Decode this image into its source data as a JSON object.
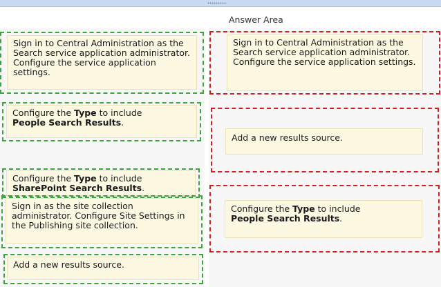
{
  "answer_area": {
    "title": "Answer Area"
  },
  "source_items": [
    {
      "text": "Sign in to Central Administration as the Search service application administrator. Configure the service application settings."
    },
    {
      "before": "Configure the ",
      "bold1": "Type",
      "middle": " to include ",
      "bold2": "People Search Results",
      "after": "."
    },
    {
      "before": "Configure the ",
      "bold1": "Type",
      "middle": " to include ",
      "bold2": "SharePoint Search Results",
      "after": "."
    },
    {
      "text": "Sign in as the site collection administrator. Configure Site Settings in the Publishing site collection."
    },
    {
      "text": "Add a new results source."
    }
  ],
  "answer_slots": [
    {
      "text": "Sign in to Central Administration as the Search service application administrator. Configure the service application settings."
    },
    {
      "text": "Add a new results source."
    },
    {
      "before": "Configure the ",
      "bold1": "Type",
      "middle": " to include ",
      "bold2": "People Search Results",
      "after": "."
    }
  ]
}
